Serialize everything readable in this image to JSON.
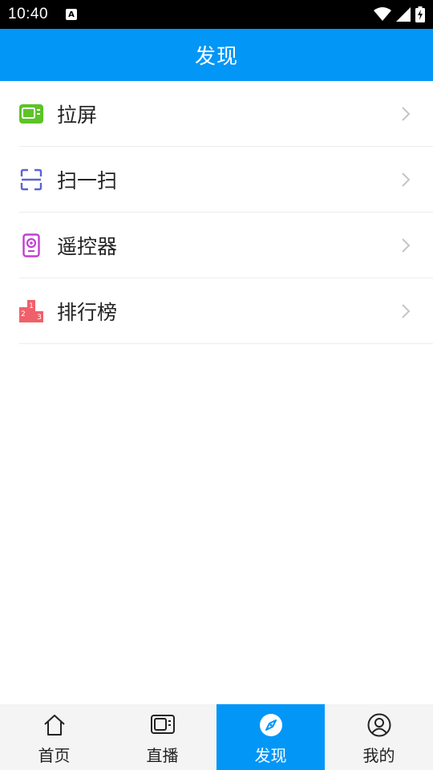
{
  "status_bar": {
    "time": "10:40",
    "notification_icon": "a-notification-icon",
    "icons": [
      "wifi-icon",
      "cell-signal-icon",
      "battery-charging-icon"
    ]
  },
  "app_bar": {
    "title": "发现"
  },
  "menu": {
    "items": [
      {
        "label": "拉屏",
        "icon": "screen-cast-icon",
        "color": "#5cc427"
      },
      {
        "label": "扫一扫",
        "icon": "scan-icon",
        "color": "#5b63d6"
      },
      {
        "label": "遥控器",
        "icon": "remote-control-icon",
        "color": "#c23fd2"
      },
      {
        "label": "排行榜",
        "icon": "podium-icon",
        "color": "#f0606a",
        "podium_numbers": [
          "1",
          "2",
          "3"
        ]
      }
    ]
  },
  "bottom_nav": {
    "items": [
      {
        "label": "首页",
        "icon": "home-icon"
      },
      {
        "label": "直播",
        "icon": "tv-icon"
      },
      {
        "label": "发现",
        "icon": "compass-icon",
        "active": true
      },
      {
        "label": "我的",
        "icon": "profile-icon"
      }
    ]
  },
  "colors": {
    "accent": "#0296f7",
    "divider": "#ededed",
    "nav_bg": "#f4f4f4"
  }
}
